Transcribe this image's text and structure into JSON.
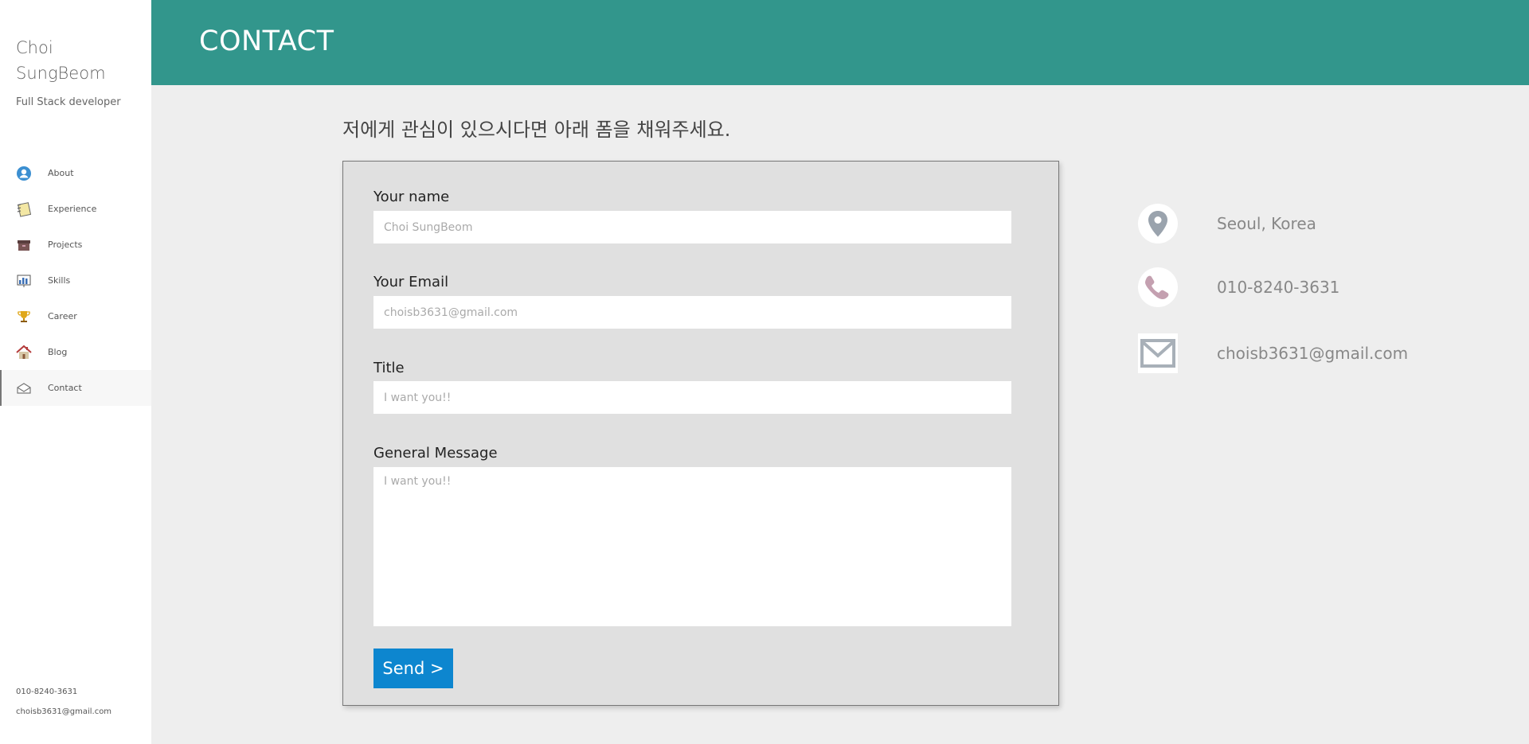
{
  "sidebar": {
    "name": "Choi SungBeom",
    "role": "Full Stack developer",
    "items": [
      {
        "label": "About",
        "icon": "user-icon"
      },
      {
        "label": "Experience",
        "icon": "notebook-icon"
      },
      {
        "label": "Projects",
        "icon": "box-icon"
      },
      {
        "label": "Skills",
        "icon": "bar-chart-icon"
      },
      {
        "label": "Career",
        "icon": "trophy-icon"
      },
      {
        "label": "Blog",
        "icon": "home-icon"
      },
      {
        "label": "Contact",
        "icon": "envelope-icon"
      }
    ],
    "active": "Contact",
    "phone": "010-8240-3631",
    "email": "choisb3631@gmail.com"
  },
  "header": {
    "title": "CONTACT",
    "color": "#32968c"
  },
  "main": {
    "intro": "저에게 관심이 있으시다면 아래 폼을 채워주세요.",
    "form": {
      "name_label": "Your name",
      "name_placeholder": "Choi SungBeom",
      "email_label": "Your Email",
      "email_placeholder": "choisb3631@gmail.com",
      "title_label": "Title",
      "title_placeholder": "I want you!!",
      "message_label": "General Message",
      "message_placeholder": "I want you!!",
      "send_label": "Send >"
    },
    "info": {
      "location": "Seoul, Korea",
      "phone": "010-8240-3631",
      "email": "choisb3631@gmail.com"
    }
  },
  "colors": {
    "accent": "#32968c",
    "button": "#0d86cf"
  }
}
